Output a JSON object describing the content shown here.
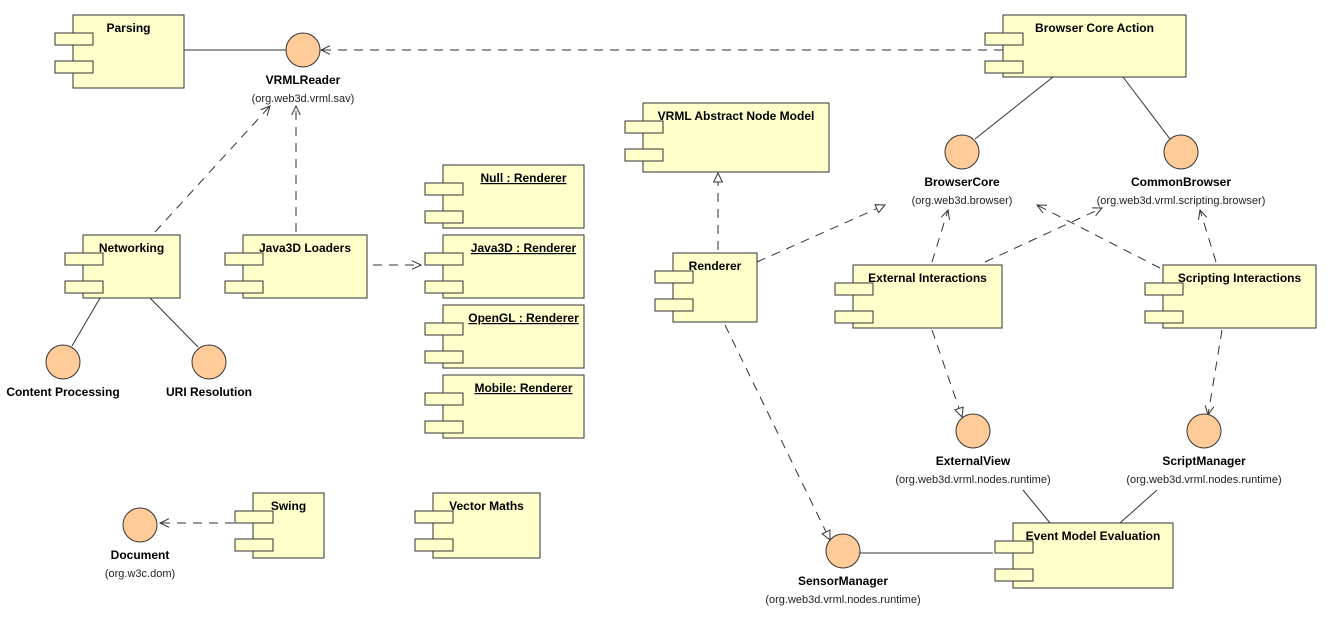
{
  "diagram_type": "UML component diagram",
  "colors": {
    "component_fill": "#ffffcc",
    "interface_fill": "#ffcc99",
    "stroke": "#333333"
  },
  "components": [
    {
      "id": "parsing",
      "label": "Parsing"
    },
    {
      "id": "browser-core-action",
      "label": "Browser Core Action"
    },
    {
      "id": "vrml-abstract-node-model",
      "label": "VRML Abstract Node Model"
    },
    {
      "id": "null-renderer",
      "label": "Null : Renderer",
      "underline": true
    },
    {
      "id": "java3d-renderer",
      "label": "Java3D : Renderer",
      "underline": true
    },
    {
      "id": "opengl-renderer",
      "label": "OpenGL : Renderer",
      "underline": true
    },
    {
      "id": "mobile-renderer",
      "label": "Mobile: Renderer",
      "underline": true
    },
    {
      "id": "networking",
      "label": "Networking"
    },
    {
      "id": "java3d-loaders",
      "label": "Java3D Loaders"
    },
    {
      "id": "renderer",
      "label": "Renderer"
    },
    {
      "id": "external-interactions",
      "label": "External Interactions"
    },
    {
      "id": "scripting-interactions",
      "label": "Scripting Interactions"
    },
    {
      "id": "swing",
      "label": "Swing"
    },
    {
      "id": "vector-maths",
      "label": "Vector Maths"
    },
    {
      "id": "event-model-evaluation",
      "label": "Event Model Evaluation"
    }
  ],
  "interfaces": [
    {
      "id": "vrmlreader",
      "label": "VRMLReader",
      "package": "(org.web3d.vrml.sav)"
    },
    {
      "id": "browsercore",
      "label": "BrowserCore",
      "package": "(org.web3d.browser)"
    },
    {
      "id": "commonbrowser",
      "label": "CommonBrowser",
      "package": "(org.web3d.vrml.scripting.browser)"
    },
    {
      "id": "content-processing",
      "label": "Content Processing",
      "package": ""
    },
    {
      "id": "uri-resolution",
      "label": "URI Resolution",
      "package": ""
    },
    {
      "id": "externalview",
      "label": "ExternalView",
      "package": "(org.web3d.vrml.nodes.runtime)"
    },
    {
      "id": "scriptmanager",
      "label": "ScriptManager",
      "package": "(org.web3d.vrml.nodes.runtime)"
    },
    {
      "id": "document",
      "label": "Document",
      "package": "(org.w3c.dom)"
    },
    {
      "id": "sensormanager",
      "label": "SensorManager",
      "package": "(org.web3d.vrml.nodes.runtime)"
    }
  ],
  "relations": [
    {
      "from": "parsing",
      "to": "vrmlreader",
      "type": "realization-line"
    },
    {
      "from": "browser-core-action",
      "to": "vrmlreader",
      "type": "dependency"
    },
    {
      "from": "networking",
      "to": "vrmlreader",
      "type": "dependency"
    },
    {
      "from": "java3d-loaders",
      "to": "vrmlreader",
      "type": "dependency"
    },
    {
      "from": "java3d-loaders",
      "to": "java3d-renderer",
      "type": "dependency"
    },
    {
      "from": "networking",
      "to": "content-processing",
      "type": "realization-line"
    },
    {
      "from": "networking",
      "to": "uri-resolution",
      "type": "realization-line"
    },
    {
      "from": "swing",
      "to": "document",
      "type": "dependency"
    },
    {
      "from": "browser-core-action",
      "to": "browsercore",
      "type": "realization-line"
    },
    {
      "from": "browser-core-action",
      "to": "commonbrowser",
      "type": "realization-line"
    },
    {
      "from": "renderer",
      "to": "vrml-abstract-node-model",
      "type": "realization"
    },
    {
      "from": "renderer",
      "to": "browsercore",
      "type": "realization"
    },
    {
      "from": "external-interactions",
      "to": "browsercore",
      "type": "dependency"
    },
    {
      "from": "external-interactions",
      "to": "commonbrowser",
      "type": "dependency"
    },
    {
      "from": "scripting-interactions",
      "to": "browsercore",
      "type": "dependency"
    },
    {
      "from": "scripting-interactions",
      "to": "commonbrowser",
      "type": "dependency"
    },
    {
      "from": "external-interactions",
      "to": "externalview",
      "type": "realization"
    },
    {
      "from": "scripting-interactions",
      "to": "scriptmanager",
      "type": "dependency"
    },
    {
      "from": "renderer",
      "to": "sensormanager",
      "type": "realization"
    },
    {
      "from": "sensormanager",
      "to": "event-model-evaluation",
      "type": "realization-line"
    },
    {
      "from": "event-model-evaluation",
      "to": "externalview",
      "type": "realization-line"
    },
    {
      "from": "event-model-evaluation",
      "to": "scriptmanager",
      "type": "realization-line"
    }
  ]
}
